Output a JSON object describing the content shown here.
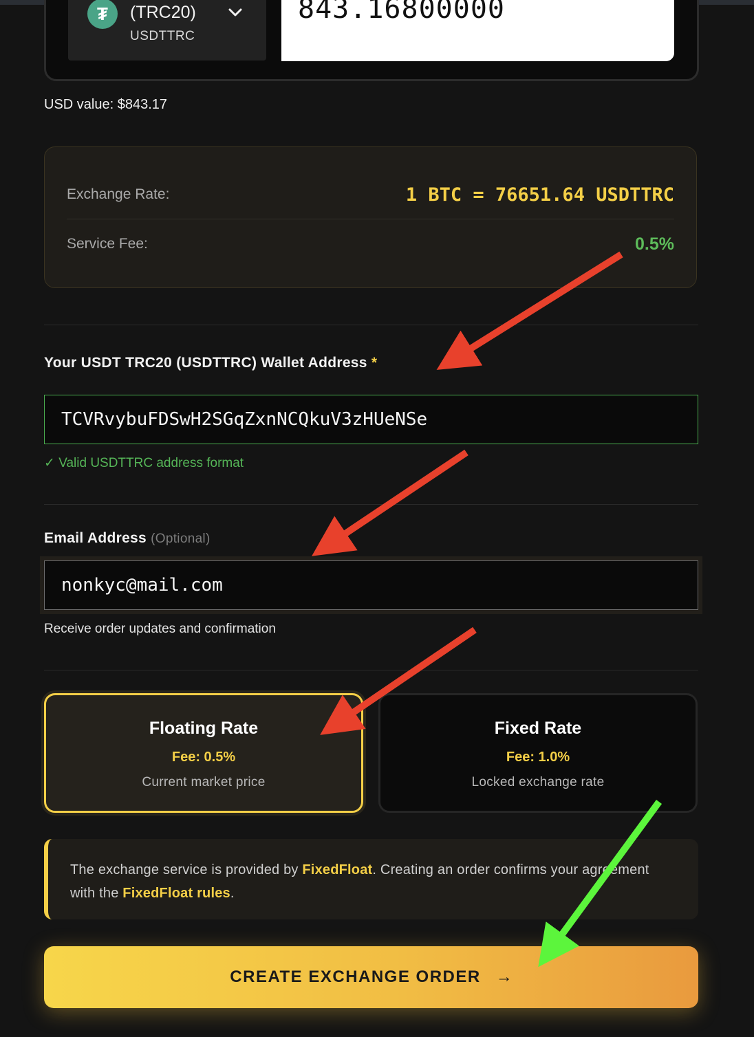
{
  "amount": {
    "network_label": "(TRC20)",
    "coin_code": "USDTTRC",
    "value": "843.16800000"
  },
  "usd_value": "USD value: $843.17",
  "rates": {
    "exchange_label": "Exchange Rate:",
    "exchange_value": "1 BTC = 76651.64 USDTTRC",
    "fee_label": "Service Fee:",
    "fee_value": "0.5%"
  },
  "wallet": {
    "label": "Your USDT TRC20 (USDTTRC) Wallet Address",
    "required_mark": "*",
    "value": "TCVRvybuFDSwH2SGqZxnNCQkuV3zHUeNSe",
    "valid_message": "✓ Valid USDTTRC address format"
  },
  "email": {
    "label": "Email Address",
    "optional": "(Optional)",
    "value": "nonkyc@mail.com",
    "help": "Receive order updates and confirmation"
  },
  "rate_options": [
    {
      "title": "Floating Rate",
      "fee": "Fee: 0.5%",
      "desc": "Current market price",
      "selected": true
    },
    {
      "title": "Fixed Rate",
      "fee": "Fee: 1.0%",
      "desc": "Locked exchange rate",
      "selected": false
    }
  ],
  "notice": {
    "text1": "The exchange service is provided by ",
    "provider": "FixedFloat",
    "text2": ". Creating an order confirms your agreement with the ",
    "rules_link": "FixedFloat rules",
    "text3": "."
  },
  "create_button": {
    "label": "CREATE EXCHANGE ORDER",
    "arrow": "→"
  },
  "colors": {
    "accent": "#f4cf47",
    "success": "#55b557",
    "annotation_red": "#e8412c",
    "annotation_green": "#5cf53c"
  }
}
